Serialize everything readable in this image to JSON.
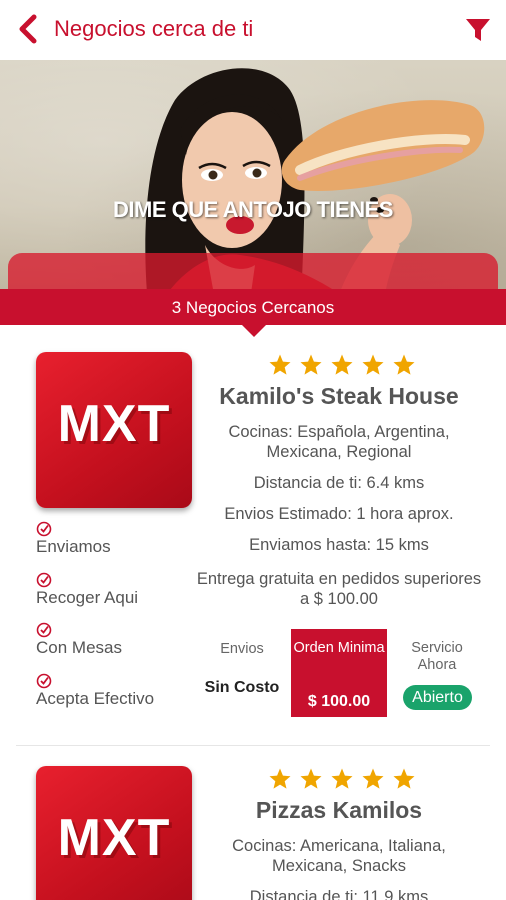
{
  "header": {
    "title": "Negocios cerca de ti"
  },
  "banner": {
    "slogan": "DIME QUE ANTOJO TIENES",
    "count_text": "3 Negocios Cercanos"
  },
  "colors": {
    "brand_red": "#c8102e",
    "star_gold": "#f0a500",
    "open_green": "#1aa36b"
  },
  "businesses": [
    {
      "logo_text": "MXT",
      "rating": 5,
      "name": "Kamilo's Steak House",
      "cuisines": "Cocinas: Española, Argentina, Mexicana, Regional",
      "distance": "Distancia de ti: 6.4 kms",
      "eta": "Envios Estimado: 1 hora aprox.",
      "range": "Enviamos hasta: 15 kms",
      "free_delivery": "Entrega gratuita en pedidos superiores a $ 100.00",
      "features": [
        "Enviamos",
        "Recoger Aqui",
        "Con Mesas",
        "Acepta Efectivo"
      ],
      "envios_label": "Envios",
      "envios_value": "Sin Costo",
      "orden_label": "Orden Minima",
      "orden_value": "$ 100.00",
      "servicio_label": "Servicio Ahora",
      "status": "Abierto"
    },
    {
      "logo_text": "MXT",
      "rating": 5,
      "name": "Pizzas Kamilos",
      "cuisines": "Cocinas: Americana, Italiana, Mexicana, Snacks",
      "distance": "Distancia de ti: 11.9 kms"
    }
  ]
}
